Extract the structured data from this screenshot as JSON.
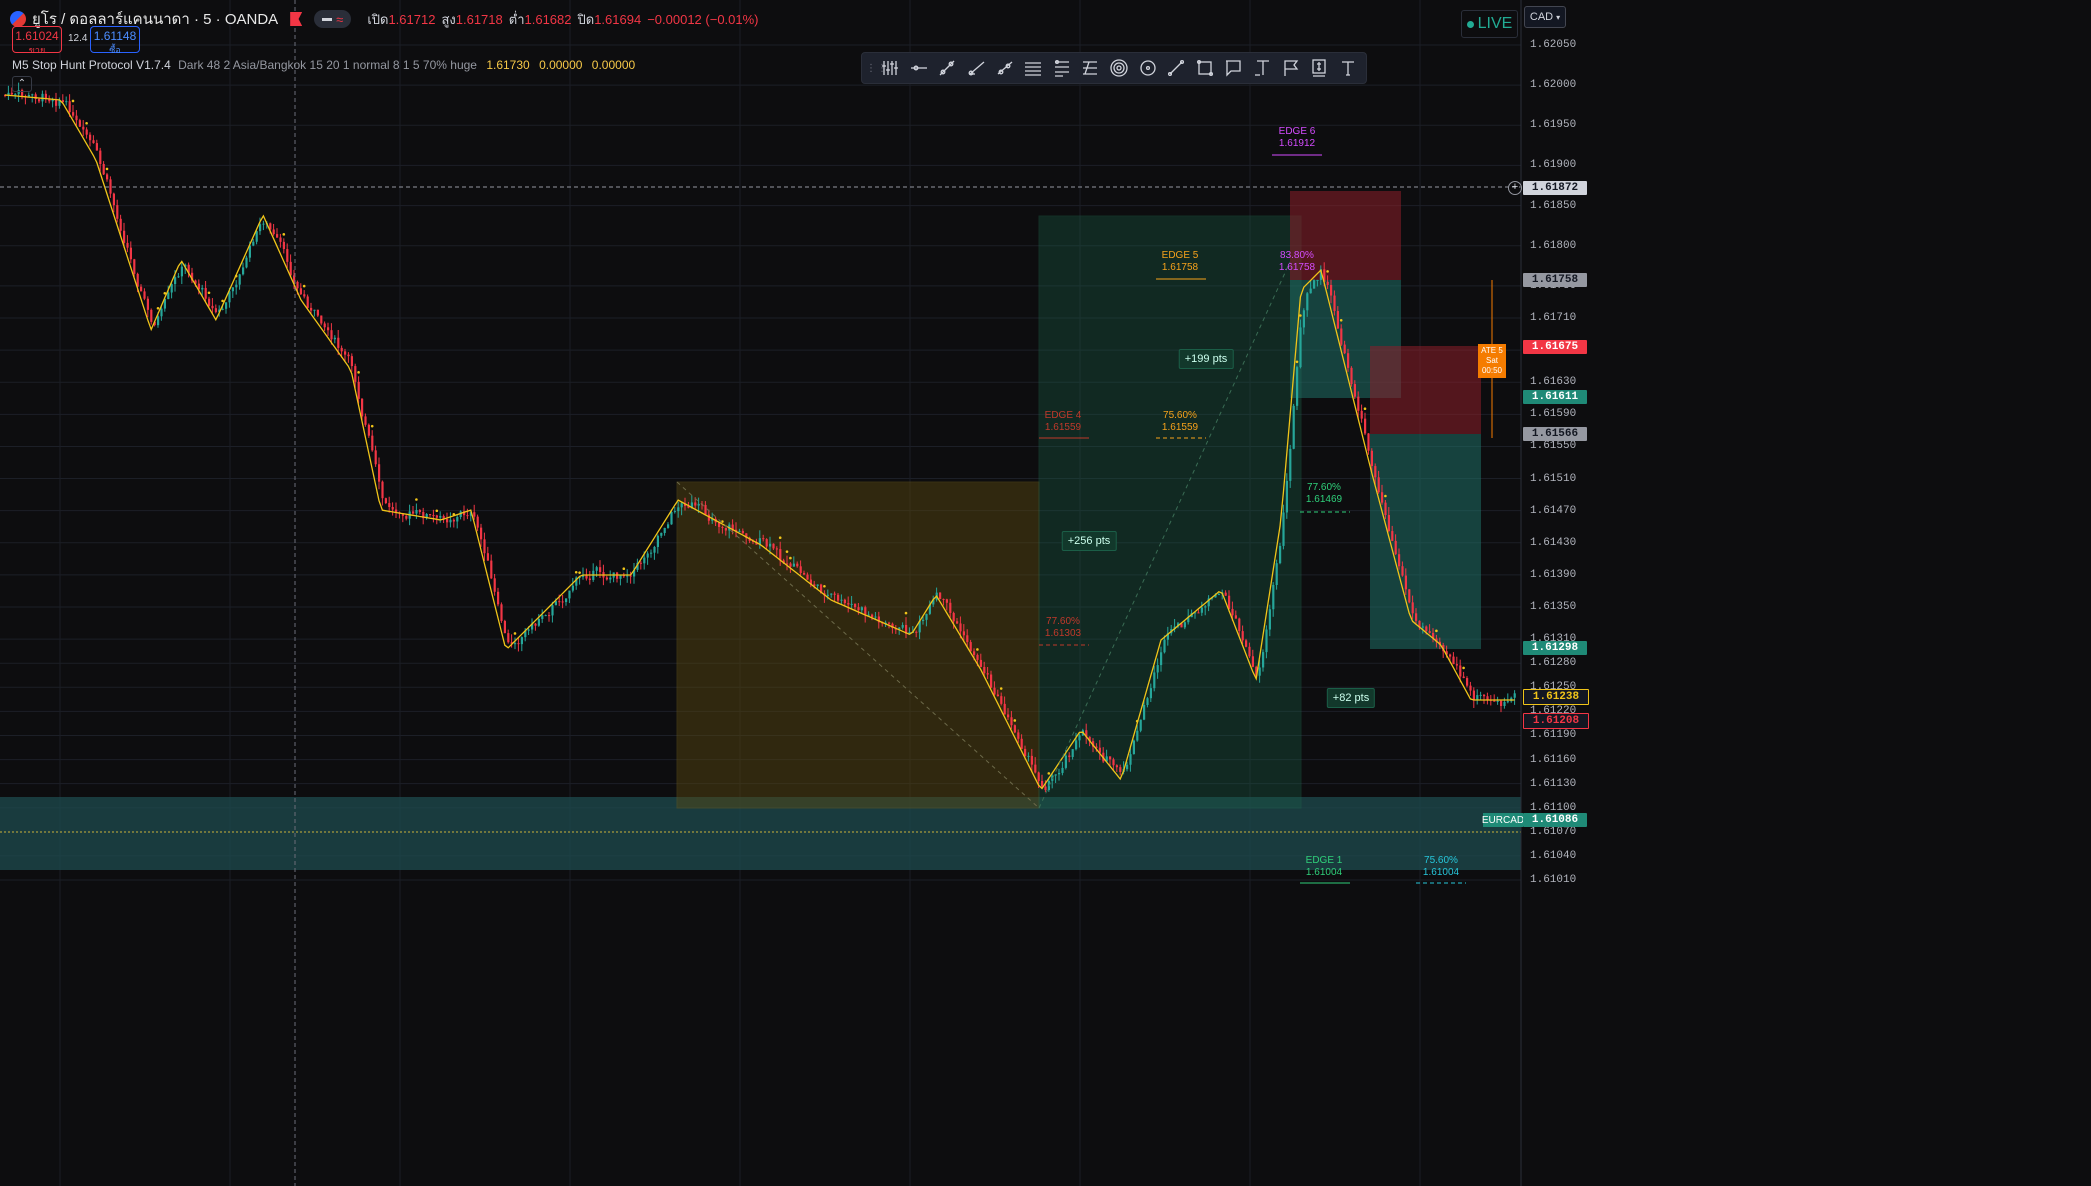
{
  "header": {
    "symbol_title": "ยูโร / ดอลลาร์แคนนาดา · 5 · OANDA",
    "open_label": "เปิด",
    "open": "1.61712",
    "high_label": "สูง",
    "high": "1.61718",
    "low_label": "ต่ำ",
    "low": "1.61682",
    "close_label": "ปิด",
    "close": "1.61694",
    "change": "−0.00012 (−0.01%)"
  },
  "trade": {
    "sell_price": "1.61024",
    "sell_label": "ขาย",
    "spread": "12.4",
    "buy_price": "1.61148",
    "buy_label": "ซื้อ"
  },
  "indicator": {
    "name": "M5 Stop Hunt Protocol V1.7.4",
    "params": "Dark 48 2 Asia/Bangkok 15 20 1 normal 8 1 5 70% huge",
    "v1": "1.61730",
    "v2": "0.00000",
    "v3": "0.00000"
  },
  "toolbar": {
    "icons": [
      "cursor-lines-icon",
      "horizontal-line-icon",
      "trend-line-icon",
      "ray-line-icon",
      "extended-line-icon",
      "parallel-channel-icon",
      "fib-retracement-icon",
      "fib-extension-icon",
      "fib-circles-icon",
      "circle-icon",
      "line-icon",
      "rectangle-icon",
      "callout-icon",
      "text-anchor-icon",
      "flag-icon",
      "price-label-icon",
      "text-icon"
    ]
  },
  "live_label": "LIVE",
  "currency": "CAD",
  "colors": {
    "up": "#26a69a",
    "down": "#f23645",
    "ma": "#f0c419",
    "orange_zone": "#f7a21b",
    "green_zone": "#1b5e47",
    "red_zone": "#8e1f2a",
    "teal_zone": "#1f6f66",
    "teal_band": "#1e4b4f"
  },
  "axis": {
    "ticks": [
      "1.62050",
      "1.62000",
      "1.61950",
      "1.61900",
      "1.61850",
      "1.61800",
      "1.61750",
      "1.61710",
      "1.61670",
      "1.61630",
      "1.61590",
      "1.61550",
      "1.61510",
      "1.61470",
      "1.61430",
      "1.61390",
      "1.61350",
      "1.61310",
      "1.61280",
      "1.61250",
      "1.61220",
      "1.61190",
      "1.61160",
      "1.61130",
      "1.61100",
      "1.61070",
      "1.61040",
      "1.61010"
    ],
    "crosshair_price": "1.61872",
    "badge_17758": "1.61758",
    "badge_current": "1.61675",
    "badge_61611": "1.61611",
    "badge_61566": "1.61566",
    "badge_61298": "1.61298",
    "badge_61238": "1.61238",
    "badge_61208": "1.61208",
    "badge_eurcad": "1.61086"
  },
  "eurcad_label": "EURCAD",
  "countdown": {
    "l1": "ATE 5",
    "l2": "Sat",
    "l3": "00:50"
  },
  "annotations": {
    "edge6_t": "EDGE 6",
    "edge6_v": "1.61912",
    "edge5_t": "EDGE 5",
    "edge5_v": "1.61758",
    "edge4_t": "EDGE 4",
    "edge4_v": "1.61559",
    "fib7560_t": "75.60%",
    "fib7560_v": "1.61559",
    "fib8380_t": "83.80%",
    "fib8380_v": "1.61758",
    "fib7760a_t": "77.60%",
    "fib7760a_v": "1.61469",
    "fib7760b_t": "77.60%",
    "fib7760b_v": "1.61303",
    "edge1_t": "EDGE 1",
    "edge1_v": "1.61004",
    "fib7560b_t": "75.60%",
    "fib7560b_v": "1.61004",
    "pts199": "+199 pts",
    "pts256": "+256 pts",
    "pts82": "+82 pts"
  }
}
